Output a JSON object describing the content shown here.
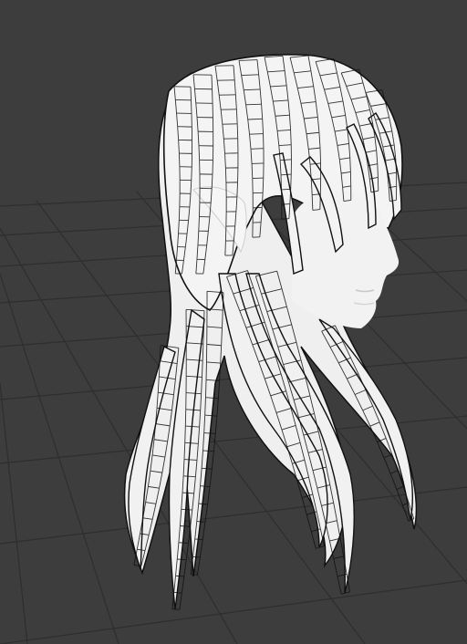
{
  "viewport": {
    "background_color": "#3d3d3d",
    "grid_line_color": "#2e2e2e",
    "model": {
      "name": "hair-mesh-wireframe",
      "surface_color": "#f2f2f2",
      "wire_color": "#111111",
      "face_color": "#ededed"
    }
  }
}
